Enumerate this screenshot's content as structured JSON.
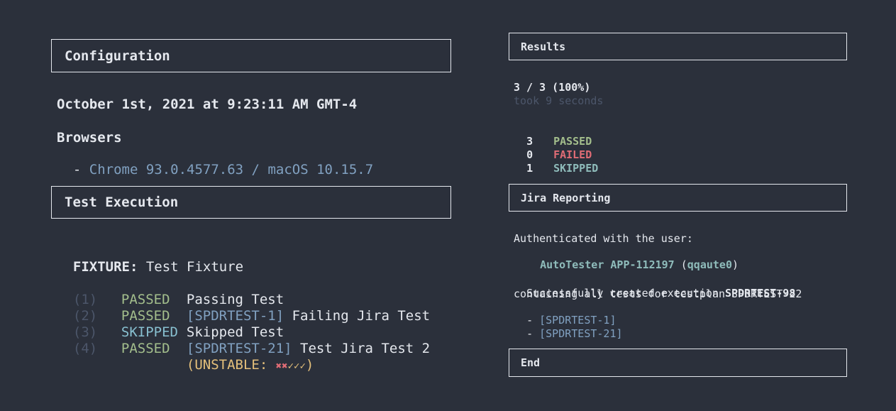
{
  "configuration": {
    "header": "Configuration",
    "date": "October 1st, 2021 at 9:23:11 AM GMT-4",
    "browsers_label": "Browsers",
    "browser_prefix": "- ",
    "browser": "Chrome 93.0.4577.63 / macOS 10.15.7"
  },
  "execution": {
    "header": "Test Execution",
    "fixture_label": "FIXTURE:",
    "fixture_name": " Test Fixture",
    "tests": [
      {
        "num": "(1)",
        "status": "PASSED",
        "issue": "",
        "name": "Passing Test"
      },
      {
        "num": "(2)",
        "status": "PASSED",
        "issue": "[SPDRTEST-1]",
        "name": " Failing Jira Test"
      },
      {
        "num": "(3)",
        "status": "SKIPPED",
        "issue": "",
        "name": "Skipped Test"
      },
      {
        "num": "(4)",
        "status": "PASSED",
        "issue": "[SPDRTEST-21]",
        "name": " Test Jira Test 2"
      }
    ],
    "unstable_open": "(UNSTABLE: ",
    "unstable_fails": "✖✖",
    "unstable_passes": "✓✓✓",
    "unstable_close": ")"
  },
  "results": {
    "header": "Results",
    "ratio": "3 / 3 (100%)",
    "took": "took 9 seconds",
    "passed_count": "3",
    "passed_label": "PASSED",
    "failed_count": "0",
    "failed_label": "FAILED",
    "skipped_count": "1",
    "skipped_label": "SKIPPED"
  },
  "jira": {
    "header": "Jira Reporting",
    "auth_line": "Authenticated with the user:",
    "user_name": "AutoTester APP-112197",
    "user_id_open": " (",
    "user_id": "qqaute0",
    "user_id_close": ")",
    "created_prefix": "Successfully created execution ",
    "execution_key": "SPDRTEST-98",
    "containing_line": "containing all tests for testplan SPDRTEST-22",
    "issues": [
      "[SPDRTEST-1]",
      "[SPDRTEST-21]"
    ],
    "issue_prefix": "- "
  },
  "end": {
    "header": "End"
  },
  "colors": {
    "background": "#2b303b",
    "passed": "#a3be8c",
    "failed": "#e06c75",
    "skipped": "#88c0d0",
    "link": "#81a1c1",
    "unstable": "#e5c07b"
  }
}
